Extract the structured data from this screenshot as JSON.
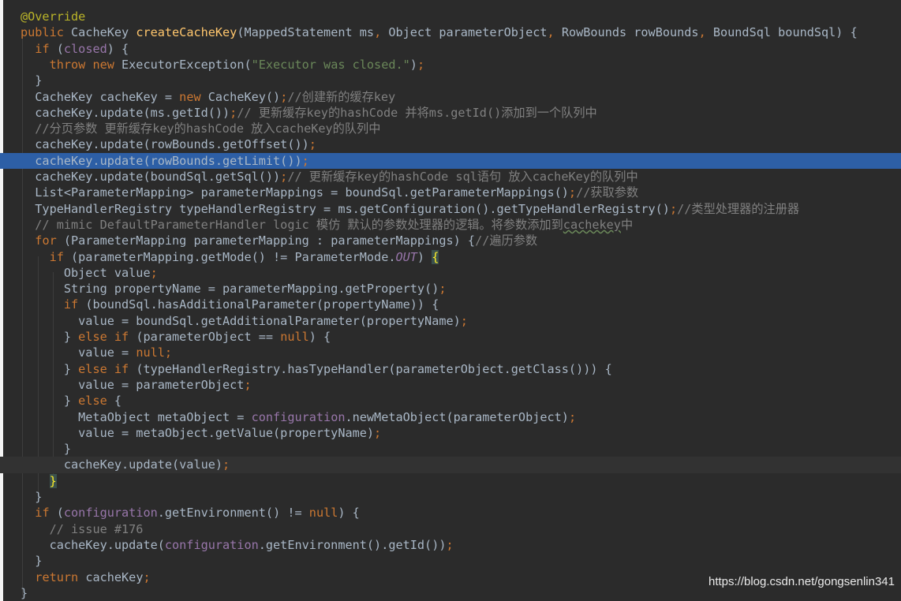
{
  "editor": {
    "lines": [
      [
        {
          "t": "@Override",
          "c": "ann"
        }
      ],
      [
        {
          "t": "public ",
          "c": "kw"
        },
        {
          "t": "CacheKey "
        },
        {
          "t": "createCacheKey",
          "c": "fn"
        },
        {
          "t": "(MappedStatement ms"
        },
        {
          "t": ", ",
          "c": "kw"
        },
        {
          "t": "Object parameterObject"
        },
        {
          "t": ", ",
          "c": "kw"
        },
        {
          "t": "RowBounds rowBounds"
        },
        {
          "t": ", ",
          "c": "kw"
        },
        {
          "t": "BoundSql boundSql) {"
        }
      ],
      [
        {
          "t": "  "
        },
        {
          "t": "if ",
          "c": "kw"
        },
        {
          "t": "("
        },
        {
          "t": "closed",
          "c": "fld"
        },
        {
          "t": ") {"
        }
      ],
      [
        {
          "t": "    "
        },
        {
          "t": "throw new ",
          "c": "kw"
        },
        {
          "t": "ExecutorException("
        },
        {
          "t": "\"Executor was closed.\"",
          "c": "str"
        },
        {
          "t": ")"
        },
        {
          "t": ";",
          "c": "kw"
        }
      ],
      [
        {
          "t": "  }"
        }
      ],
      [
        {
          "t": "  CacheKey cacheKey = "
        },
        {
          "t": "new ",
          "c": "kw"
        },
        {
          "t": "CacheKey()"
        },
        {
          "t": ";",
          "c": "kw"
        },
        {
          "t": "//创建新的缓存key",
          "c": "cmt"
        }
      ],
      [
        {
          "t": "  cacheKey.update(ms.getId())"
        },
        {
          "t": ";",
          "c": "kw"
        },
        {
          "t": "// 更新缓存key的hashCode 并将ms.getId()添加到一个队列中",
          "c": "cmt"
        }
      ],
      [
        {
          "t": "  "
        },
        {
          "t": "//分页参数 更新缓存key的hashCode 放入cacheKey的队列中",
          "c": "cmt"
        }
      ],
      [
        {
          "t": "  cacheKey.update(rowBounds.getOffset())"
        },
        {
          "t": ";",
          "c": "kw"
        }
      ],
      [
        {
          "t": "  cacheKey.update(rowBounds.getLimit())"
        },
        {
          "t": ";",
          "c": "kw"
        }
      ],
      [
        {
          "t": "  cacheKey.update(boundSql.getSql())"
        },
        {
          "t": ";",
          "c": "kw"
        },
        {
          "t": "// 更新缓存key的hashCode sql语句 放入cacheKey的队列中",
          "c": "cmt"
        }
      ],
      [
        {
          "t": "  List<ParameterMapping> parameterMappings = boundSql.getParameterMappings()"
        },
        {
          "t": ";",
          "c": "kw"
        },
        {
          "t": "//获取参数",
          "c": "cmt"
        }
      ],
      [
        {
          "t": "  TypeHandlerRegistry typeHandlerRegistry = ms.getConfiguration().getTypeHandlerRegistry()"
        },
        {
          "t": ";",
          "c": "kw"
        },
        {
          "t": "//类型处理器的注册器",
          "c": "cmt"
        }
      ],
      [
        {
          "t": "  "
        },
        {
          "t": "// mimic DefaultParameterHandler logic 模仿 默认的参数处理器的逻辑。将参数添加到",
          "c": "cmt"
        },
        {
          "t": "cachekey",
          "c": "cmt underline"
        },
        {
          "t": "中",
          "c": "cmt"
        }
      ],
      [
        {
          "t": "  "
        },
        {
          "t": "for ",
          "c": "kw"
        },
        {
          "t": "(ParameterMapping parameterMapping : parameterMappings) {"
        },
        {
          "t": "//遍历参数",
          "c": "cmt"
        }
      ],
      [
        {
          "t": "    "
        },
        {
          "t": "if ",
          "c": "kw"
        },
        {
          "t": "(parameterMapping.getMode() != ParameterMode."
        },
        {
          "t": "OUT",
          "c": "enumc"
        },
        {
          "t": ") "
        },
        {
          "t": "{",
          "c": "brace-match"
        }
      ],
      [
        {
          "t": "      Object value"
        },
        {
          "t": ";",
          "c": "kw"
        }
      ],
      [
        {
          "t": "      String propertyName = parameterMapping.getProperty()"
        },
        {
          "t": ";",
          "c": "kw"
        }
      ],
      [
        {
          "t": "      "
        },
        {
          "t": "if ",
          "c": "kw"
        },
        {
          "t": "(boundSql.hasAdditionalParameter(propertyName)) {"
        }
      ],
      [
        {
          "t": "        value = boundSql.getAdditionalParameter(propertyName)"
        },
        {
          "t": ";",
          "c": "kw"
        }
      ],
      [
        {
          "t": "      } "
        },
        {
          "t": "else if ",
          "c": "kw"
        },
        {
          "t": "(parameterObject == "
        },
        {
          "t": "null",
          "c": "kw"
        },
        {
          "t": ") {"
        }
      ],
      [
        {
          "t": "        value = "
        },
        {
          "t": "null;",
          "c": "kw"
        }
      ],
      [
        {
          "t": "      } "
        },
        {
          "t": "else if ",
          "c": "kw"
        },
        {
          "t": "(typeHandlerRegistry.hasTypeHandler(parameterObject.getClass())) {"
        }
      ],
      [
        {
          "t": "        value = parameterObject"
        },
        {
          "t": ";",
          "c": "kw"
        }
      ],
      [
        {
          "t": "      } "
        },
        {
          "t": "else ",
          "c": "kw"
        },
        {
          "t": "{"
        }
      ],
      [
        {
          "t": "        MetaObject metaObject = "
        },
        {
          "t": "configuration",
          "c": "fld"
        },
        {
          "t": ".newMetaObject(parameterObject)"
        },
        {
          "t": ";",
          "c": "kw"
        }
      ],
      [
        {
          "t": "        value = metaObject.getValue(propertyName)"
        },
        {
          "t": ";",
          "c": "kw"
        }
      ],
      [
        {
          "t": "      }"
        }
      ],
      [
        {
          "t": "      cacheKey.update(value)"
        },
        {
          "t": ";",
          "c": "kw"
        }
      ],
      [
        {
          "t": "    "
        },
        {
          "t": "}",
          "c": "brace-match"
        }
      ],
      [
        {
          "t": "  }"
        }
      ],
      [
        {
          "t": "  "
        },
        {
          "t": "if ",
          "c": "kw"
        },
        {
          "t": "("
        },
        {
          "t": "configuration",
          "c": "fld"
        },
        {
          "t": ".getEnvironment() != "
        },
        {
          "t": "null",
          "c": "kw"
        },
        {
          "t": ") {"
        }
      ],
      [
        {
          "t": "    "
        },
        {
          "t": "// issue #176",
          "c": "cmt"
        }
      ],
      [
        {
          "t": "    cacheKey.update("
        },
        {
          "t": "configuration",
          "c": "fld"
        },
        {
          "t": ".getEnvironment().getId())"
        },
        {
          "t": ";",
          "c": "kw"
        }
      ],
      [
        {
          "t": "  }"
        }
      ],
      [
        {
          "t": "  "
        },
        {
          "t": "return ",
          "c": "kw"
        },
        {
          "t": "cacheKey"
        },
        {
          "t": ";",
          "c": "kw"
        }
      ],
      [
        {
          "t": "}"
        }
      ]
    ],
    "highlighted_line": 9,
    "caret_line": 28
  },
  "watermark": "https://blog.csdn.net/gongsenlin341",
  "colors": {
    "background": "#2b2b2b",
    "selection": "#2d5fa6",
    "keyword": "#cc7832",
    "method": "#ffc66d",
    "string": "#6a8759",
    "comment": "#808080",
    "annotation": "#bbb529",
    "field": "#9876aa",
    "text": "#a9b7c6"
  }
}
